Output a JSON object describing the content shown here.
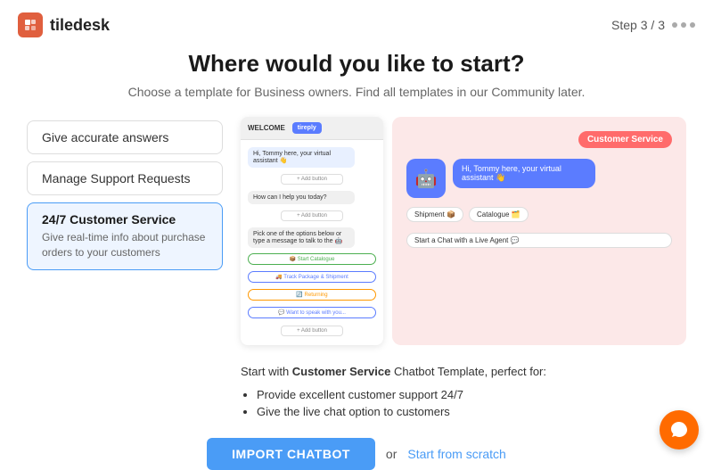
{
  "header": {
    "logo_text": "tiledesk",
    "step_label": "Step",
    "step_current": "3",
    "step_total": "3"
  },
  "page": {
    "title": "Where would you like to start?",
    "subtitle": "Choose a template for Business owners. Find all templates in our Community later."
  },
  "templates": [
    {
      "id": "give-accurate",
      "title": "Give accurate answers",
      "desc": "",
      "active": false
    },
    {
      "id": "manage-support",
      "title": "Manage Support Requests",
      "desc": "",
      "active": false
    },
    {
      "id": "customer-service",
      "title": "24/7 Customer Service",
      "desc": "Give real-time info about purchase orders to your customers",
      "active": true
    }
  ],
  "preview": {
    "chat_header_title": "WELCOME",
    "chat_brand": "tireply",
    "chat_greeting": "Hi, Tommy here, your virtual assistant 👋",
    "chat_question": "How can I help you today?",
    "chat_option_text": "Pick one of the options below or type a message to talk to the 🤖",
    "chat_options": [
      "📦 Start Catalogue",
      "🚚 Track Package & Shipment",
      "🔄 Returning",
      "💬 Want to speak with you..."
    ],
    "cs_badge": "Customer Service",
    "cs_greeting": "Hi, Tommy here, your virtual assistant 👋",
    "cs_options": [
      "Shipment 📦",
      "Catalogue 🗂️",
      "Start a Chat with a Live Agent 💬"
    ]
  },
  "info": {
    "text_prefix": "Start with ",
    "text_bold": "Customer Service",
    "text_suffix": " Chatbot Template, perfect for:",
    "bullets": [
      "Provide excellent customer support 24/7",
      "Give the live chat option to customers"
    ]
  },
  "footer": {
    "import_label": "IMPORT CHATBOT",
    "or_text": "or",
    "scratch_label": "Start from scratch"
  }
}
